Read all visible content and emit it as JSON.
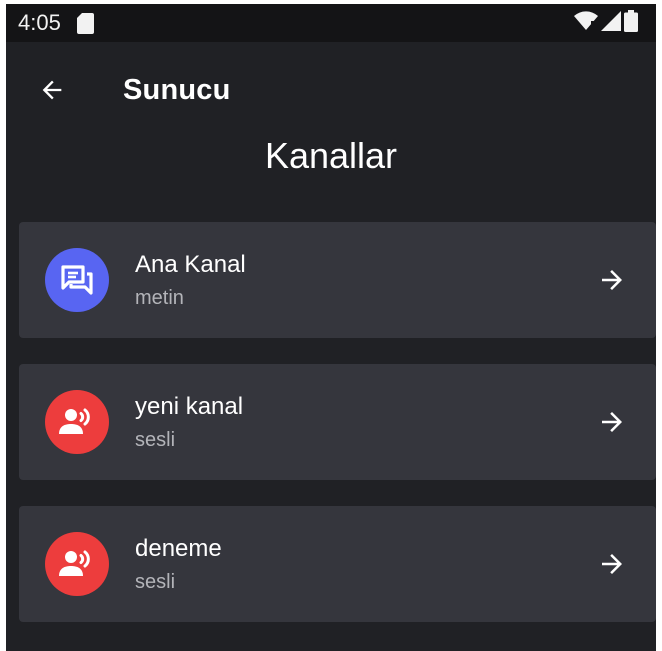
{
  "status_bar": {
    "time": "4:05",
    "icons": [
      "sd-card-icon",
      "wifi-icon",
      "signal-icon",
      "battery-icon"
    ]
  },
  "app_bar": {
    "title": "Sunucu",
    "back_icon": "arrow-left-icon"
  },
  "page": {
    "heading": "Kanallar"
  },
  "channels": [
    {
      "name": "Ana Kanal",
      "type": "metin",
      "icon": "chat-icon",
      "color": "#5865f2"
    },
    {
      "name": "yeni kanal",
      "type": "sesli",
      "icon": "voice-icon",
      "color": "#ed3d3d"
    },
    {
      "name": "deneme",
      "type": "sesli",
      "icon": "voice-icon",
      "color": "#ed3d3d"
    }
  ],
  "colors": {
    "background": "#202125",
    "status_bar": "#141416",
    "card": "#35363d",
    "text_secondary": "#b3b4b9"
  }
}
